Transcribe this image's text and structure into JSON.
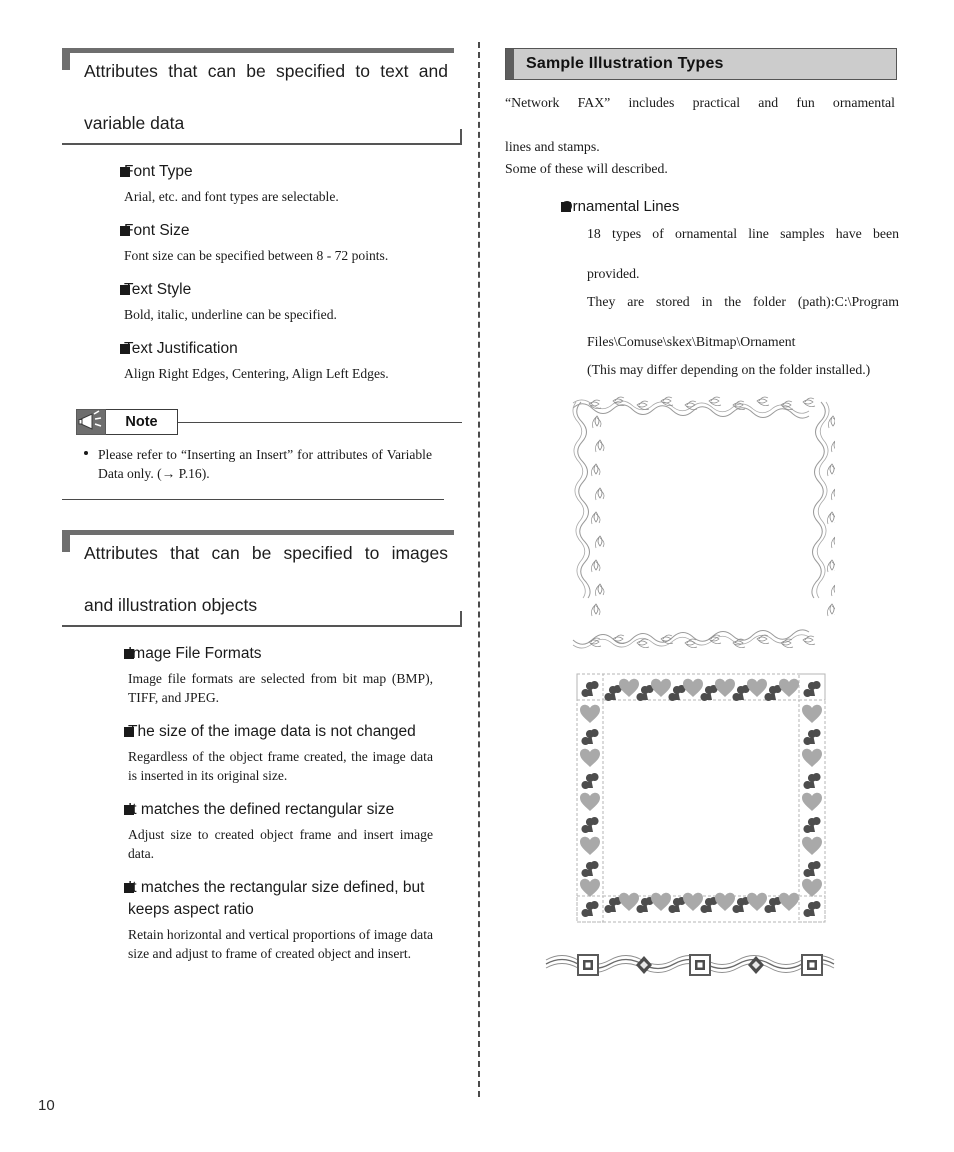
{
  "page": {
    "number": "10"
  },
  "left_column": {
    "section1": {
      "heading_line1": "Attributes that can be specified to text and",
      "heading_line2": "variable data",
      "items": [
        {
          "title": "Font Type",
          "desc": "Arial, etc. and font types are selectable."
        },
        {
          "title": "Font Size",
          "desc": "Font size can be specified between 8 - 72 points."
        },
        {
          "title": "Text Style",
          "desc": "Bold, italic, underline can be specified."
        },
        {
          "title": "Text Justification",
          "desc": "Align Right Edges, Centering, Align Left Edges."
        }
      ],
      "note": {
        "icon": "megaphone-icon",
        "label": "Note",
        "text": "Please refer to “Inserting an Insert” for attributes of Variable Data only. (→ P.16)."
      }
    },
    "section2": {
      "heading_line1": "Attributes that can be specified to images",
      "heading_line2": "and illustration objects",
      "items": [
        {
          "title": "Image File Formats",
          "desc": "Image file formats are selected from bit map (BMP), TIFF, and JPEG."
        },
        {
          "title": "The size of the image data is not changed",
          "desc": "Regardless of the object frame created, the image data is inserted in its original size."
        },
        {
          "title": "It matches the defined rectangular size",
          "desc": "Adjust size to created object frame and insert image data."
        },
        {
          "title_line1": "It matches the rectangular size defined, but",
          "title_line2": "keeps aspect ratio",
          "title": "It matches the rectangular size defined, but keeps aspect ratio",
          "desc": "Retain horizontal and vertical proportions of image data size and adjust to frame of created object and insert."
        }
      ]
    }
  },
  "right_column": {
    "header": {
      "title": "Sample Illustration Types",
      "bg_color": "#cccccc",
      "bar_color": "#5d5d5d"
    },
    "intro_line1": "“Network FAX” includes practical and fun ornamental",
    "intro_line2": "lines and stamps.",
    "intro_line3": "Some of these will described.",
    "item": {
      "title": "Ornamental Lines",
      "p1_line1": "18 types of ornamental line samples have been",
      "p1_line2": "provided.",
      "p2_line1": "They are stored in the folder (path):C:\\Program",
      "p2_line2": "Files\\Comuse\\skex\\Bitmap\\Ornament",
      "p3": "(This may differ depending on the folder installed.)"
    },
    "illustrations": [
      {
        "name": "ornamental-frame-vine",
        "caption": ""
      },
      {
        "name": "ornamental-frame-hearts",
        "caption": ""
      },
      {
        "name": "ornamental-line-wave",
        "caption": ""
      }
    ]
  },
  "colors": {
    "rule": "#4a4a4a",
    "bracket": "#6e6e6e",
    "bullet": "#1a1a1a",
    "ornament_gray": "#9a9a9a",
    "ornament_dark": "#4d4d4d"
  }
}
